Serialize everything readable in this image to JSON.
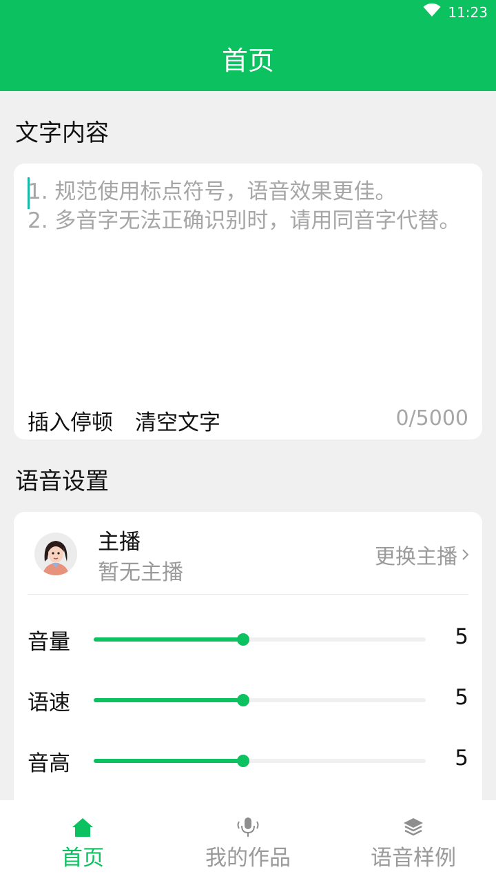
{
  "status_bar": {
    "time": "11:23",
    "wifi_icon": "wifi-icon"
  },
  "app_bar": {
    "title": "首页"
  },
  "text_section": {
    "title": "文字内容",
    "value": "",
    "placeholder": "1. 规范使用标点符号，语音效果更佳。\n2. 多音字无法正确识别时，请用同音字代替。",
    "insert_pause_label": "插入停顿",
    "clear_text_label": "清空文字",
    "char_count": "0/5000"
  },
  "voice_section": {
    "title": "语音设置",
    "anchor_label": "主播",
    "anchor_value": "暂无主播",
    "change_anchor_label": "更换主播",
    "sliders": [
      {
        "label": "音量",
        "value": "5",
        "level": 0.45
      },
      {
        "label": "语速",
        "value": "5",
        "level": 0.45
      },
      {
        "label": "音高",
        "value": "5",
        "level": 0.45
      }
    ]
  },
  "bottom_nav": {
    "items": [
      {
        "label": "首页",
        "icon": "home-icon",
        "active": true
      },
      {
        "label": "我的作品",
        "icon": "microphone-icon",
        "active": false
      },
      {
        "label": "语音样例",
        "icon": "layers-icon",
        "active": false
      }
    ]
  },
  "colors": {
    "accent": "#0cc160",
    "background": "#f0f0f0",
    "muted_text": "#9a9a9a"
  }
}
